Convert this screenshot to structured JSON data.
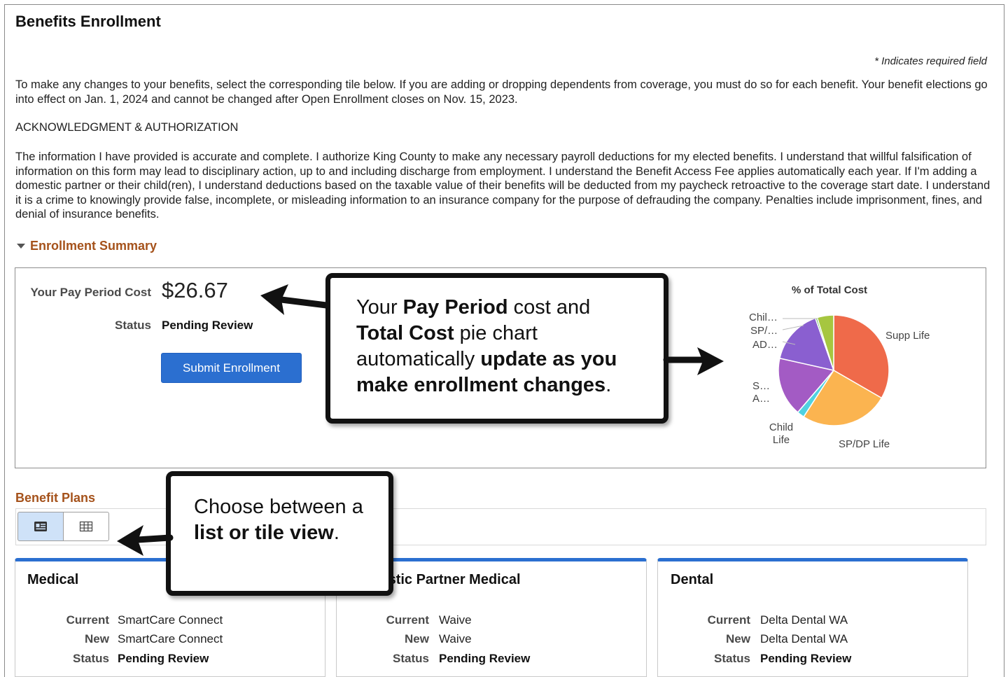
{
  "page": {
    "title": "Benefits Enrollment",
    "required_note": "* Indicates required field",
    "intro": "To make any changes to your benefits, select the corresponding tile below.  If you are adding or dropping dependents from coverage, you must do so for each benefit. Your benefit elections go into effect on Jan. 1, 2024 and cannot be changed after Open Enrollment closes on Nov. 15, 2023.",
    "ack_heading": "ACKNOWLEDGMENT & AUTHORIZATION",
    "ack_text": "The information I have provided is accurate and complete. I authorize King County to make any necessary payroll deductions for my elected benefits. I understand that willful falsification of information on this form may lead to disciplinary action, up to and including discharge from employment. I understand the Benefit Access Fee applies automatically each year. If I'm adding a domestic partner or their child(ren), I understand deductions based on the taxable value of their benefits will be deducted from my paycheck retroactive to the coverage start date. I understand it is a crime to knowingly provide false, incomplete, or misleading information to an insurance company for the purpose of defrauding the company. Penalties include imprisonment, fines, and denial of insurance benefits."
  },
  "summary": {
    "section_label": "Enrollment Summary",
    "cost_label": "Your Pay Period Cost",
    "cost_value": "$26.67",
    "status_label": "Status",
    "status_value": "Pending Review",
    "submit_label": "Submit Enrollment"
  },
  "callouts": {
    "pay_period": {
      "t1": "Your ",
      "b1": "Pay Period",
      "t2": " cost and ",
      "b2": "Total Cost",
      "t3": " pie chart automatically ",
      "b3": "update as you make enrollment changes",
      "t4": "."
    },
    "view": {
      "t1": "Choose between a ",
      "b1": "list or tile view",
      "t2": "."
    }
  },
  "chart_data": {
    "type": "pie",
    "title": "% of Total Cost",
    "slices": [
      {
        "label": "Supp Life",
        "value": 31,
        "color": "#ef6a4a"
      },
      {
        "label": "SP/DP Life",
        "value": 24,
        "color": "#fbb450"
      },
      {
        "label": "Child Life",
        "value": 2,
        "color": "#4fd2e0"
      },
      {
        "label": "S… A…",
        "value": 16,
        "color": "#a35bc4"
      },
      {
        "label": "AD…",
        "value": 15,
        "color": "#8a5fd0"
      },
      {
        "label": "SP/…",
        "value": 0.5,
        "color": "#6dbf6a"
      },
      {
        "label": "Chil…",
        "value": 4.5,
        "color": "#a6c640"
      }
    ],
    "legend": "none"
  },
  "plans": {
    "title": "Benefit Plans",
    "tiles": [
      {
        "title": "Medical",
        "current": "SmartCare Connect",
        "new": "SmartCare Connect",
        "status": "Pending Review"
      },
      {
        "title": "Domestic Partner Medical",
        "current": "Waive",
        "new": "Waive",
        "status": "Pending Review"
      },
      {
        "title": "Dental",
        "current": "Delta Dental WA",
        "new": "Delta Dental WA",
        "status": "Pending Review"
      }
    ],
    "row_labels": {
      "current": "Current",
      "new": "New",
      "status": "Status"
    }
  }
}
